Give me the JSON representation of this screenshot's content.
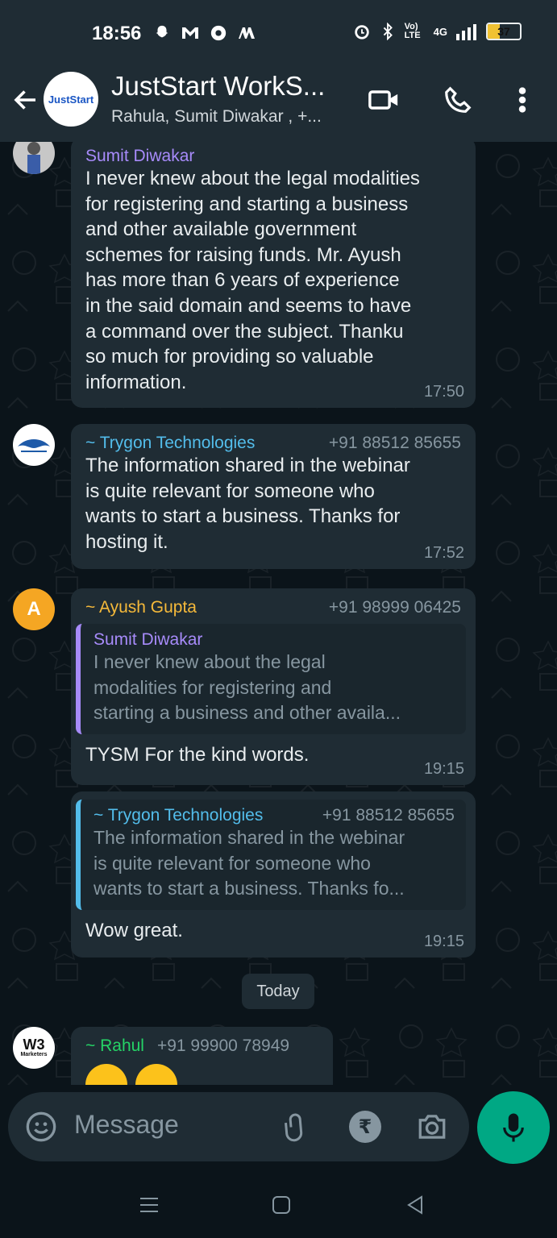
{
  "status_bar": {
    "time": "18:56",
    "left_icons": [
      "snapchat-icon",
      "gmail-icon",
      "chrome-icon",
      "mail-icon"
    ],
    "right_icons": [
      "alarm-icon",
      "bluetooth-icon",
      "volte-icon",
      "4g-signal-icon",
      "signal-bars-icon"
    ],
    "volte_label": "Vo) LTE",
    "network_label": "4G",
    "battery_level": "37"
  },
  "header": {
    "back_icon": "arrow-back-icon",
    "group_avatar_text": "JustStart",
    "title": "JustStart WorkS...",
    "subtitle": "Rahula, Sumit Diwakar , +...",
    "video_icon": "video-call-icon",
    "call_icon": "phone-call-icon",
    "menu_icon": "more-vert-icon"
  },
  "messages": [
    {
      "sender": "Sumit Diwakar",
      "phone": "",
      "sender_color": "#a78bfa",
      "text_lines": [
        "I never knew about the legal modalities",
        "for registering and starting a business",
        "and other available government",
        "schemes for raising funds. Mr. Ayush",
        "has more than 6 years of experience",
        "in the said domain and seems to have",
        "a command over the subject. Thanku",
        "so much for providing so valuable",
        "information."
      ],
      "time": "17:50"
    },
    {
      "sender": "~ Trygon Technologies",
      "phone": "+91 88512 85655",
      "sender_color": "#53bdeb",
      "text_lines": [
        "The information shared in the webinar",
        "is quite relevant for someone who",
        "wants to start a business. Thanks for",
        "hosting it."
      ],
      "time": "17:52"
    },
    {
      "sender": "~ Ayush Gupta",
      "phone": "+91 98999 06425",
      "sender_color": "#f5b93a",
      "avatar_letter": "A",
      "quote": {
        "name": "Sumit Diwakar",
        "lines": [
          "I never knew about the legal",
          "modalities for registering and",
          "starting a business and other availa..."
        ]
      },
      "text": "TYSM For the kind words.",
      "time": "19:15"
    },
    {
      "quote": {
        "name": "~ Trygon Technologies",
        "phone": "+91 88512 85655",
        "lines": [
          "The information shared in the webinar",
          "is quite relevant for someone who",
          "wants to start a business. Thanks fo..."
        ]
      },
      "text": "Wow great.",
      "time": "19:15"
    },
    {
      "sender": "~ Rahul",
      "phone": "+91 99900 78949",
      "sender_color": "#25d366",
      "avatar_text": "W3",
      "avatar_sub": "Marketers"
    }
  ],
  "day_chip": "Today",
  "input": {
    "placeholder": "Message",
    "emoji_icon": "emoji-icon",
    "attach_icon": "paperclip-icon",
    "payment_icon": "rupee-icon",
    "payment_symbol": "₹",
    "camera_icon": "camera-icon",
    "mic_icon": "mic-icon"
  },
  "colors": {
    "accent": "#00a884",
    "bubble": "#1f2c34",
    "background": "#0b141a"
  }
}
